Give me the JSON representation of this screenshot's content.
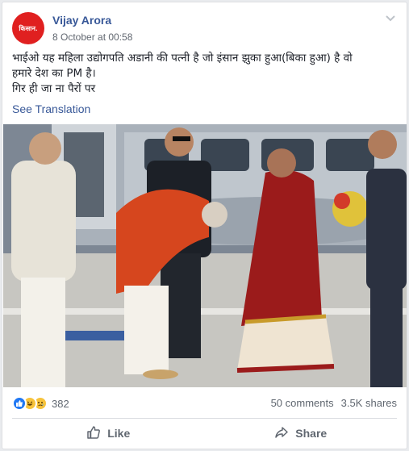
{
  "post": {
    "avatar_text": "किसान.",
    "author": "Vijay Arora",
    "timestamp": "8 October at 00:58",
    "text_lines": [
      "भाईओ यह महिला उद्योगपति अडानी की पत्नी है जो इंसान झुका हुआ(बिका हुआ) है वो",
      "हमारे देश का PM है।",
      "गिर ही जा ना पैरों पर"
    ],
    "see_translation": "See Translation",
    "options_icon": "chevron-down-icon"
  },
  "stats": {
    "reaction_icons": [
      "like-reaction-icon",
      "haha-reaction-icon",
      "sad-reaction-icon"
    ],
    "reaction_count": "382",
    "comments": "50 comments",
    "shares": "3.5K shares"
  },
  "actions": {
    "like_label": "Like",
    "share_label": "Share"
  },
  "colors": {
    "author_link": "#385898",
    "avatar_red": "#e02020",
    "like_blue": "#2078f4",
    "secondary_text": "#606770"
  }
}
